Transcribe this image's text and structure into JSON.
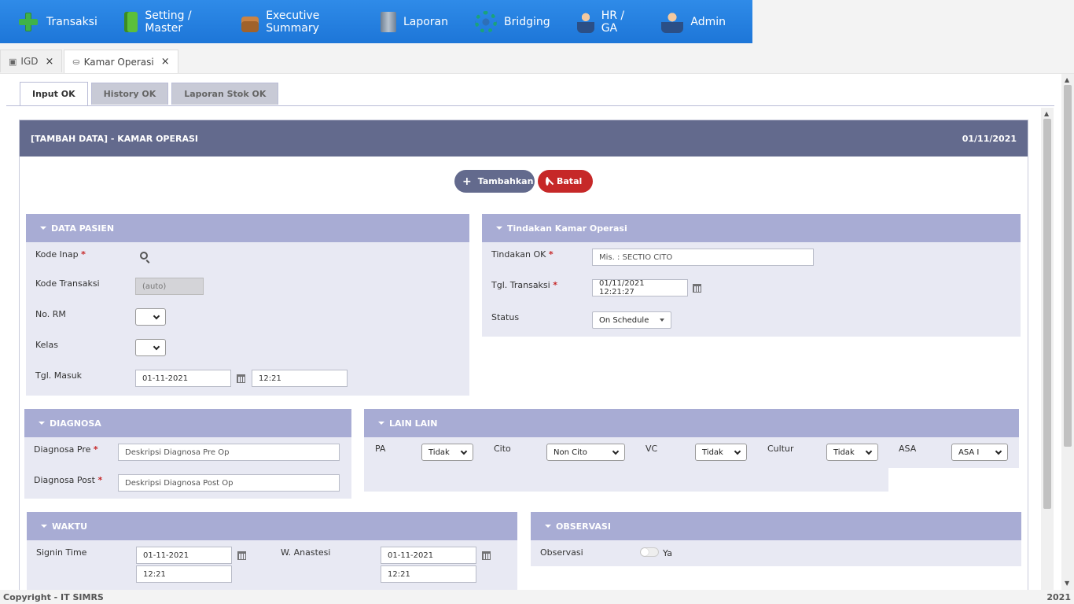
{
  "menu": {
    "items": [
      {
        "label": "Transaksi",
        "icon": "plus-icon"
      },
      {
        "label": "Setting / Master",
        "icon": "book-icon"
      },
      {
        "label": "Executive Summary",
        "icon": "briefcase-icon"
      },
      {
        "label": "Laporan",
        "icon": "server-icon"
      },
      {
        "label": "Bridging",
        "icon": "gear-icon"
      },
      {
        "label": "HR / GA",
        "icon": "user-icon"
      },
      {
        "label": "Admin",
        "icon": "admin-icon"
      }
    ]
  },
  "doc_tabs": [
    {
      "label": "IGD",
      "close": "×"
    },
    {
      "label": "Kamar Operasi",
      "close": "×"
    }
  ],
  "sub_tabs": [
    "Input OK",
    "History OK",
    "Laporan Stok OK"
  ],
  "form": {
    "title": "[TAMBAH DATA] - KAMAR OPERASI",
    "date": "01/11/2021",
    "btn_add": "Tambahkan",
    "btn_cancel": "Batal",
    "required_mark": "*"
  },
  "data_pasien": {
    "title": "DATA PASIEN",
    "kode_inap_label": "Kode Inap",
    "kode_transaksi_label": "Kode Transaksi",
    "kode_transaksi_value": "(auto)",
    "no_rm_label": "No. RM",
    "kelas_label": "Kelas",
    "tgl_masuk_label": "Tgl. Masuk",
    "tgl_masuk_date": "01-11-2021",
    "tgl_masuk_time": "12:21"
  },
  "tindakan": {
    "title": "Tindakan Kamar Operasi",
    "tindakan_label": "Tindakan OK",
    "tindakan_placeholder": "Mis. : SECTIO CITO",
    "tgl_label": "Tgl. Transaksi",
    "tgl_value": "01/11/2021 12:21:27",
    "status_label": "Status",
    "status_value": "On Schedule"
  },
  "diagnosa": {
    "title": "DIAGNOSA",
    "pre_label": "Diagnosa Pre",
    "pre_placeholder": "Deskripsi Diagnosa Pre Op",
    "post_label": "Diagnosa Post",
    "post_placeholder": "Deskripsi Diagnosa Post Op"
  },
  "lain": {
    "title": "LAIN LAIN",
    "pa_label": "PA",
    "pa_value": "Tidak",
    "cito_label": "Cito",
    "cito_value": "Non Cito",
    "vc_label": "VC",
    "vc_value": "Tidak",
    "cultur_label": "Cultur",
    "cultur_value": "Tidak",
    "asa_label": "ASA",
    "asa_value": "ASA I"
  },
  "waktu": {
    "title": "WAKTU",
    "signin_label": "Signin Time",
    "signin_date": "01-11-2021",
    "signin_time": "12:21",
    "anastesi_label": "W. Anastesi",
    "anastesi_date": "01-11-2021",
    "anastesi_time": "12:21"
  },
  "observasi": {
    "title": "OBSERVASI",
    "label": "Observasi",
    "toggle_label": "Ya"
  },
  "footer": {
    "left": "Copyright - IT SIMRS",
    "right": "2021"
  }
}
